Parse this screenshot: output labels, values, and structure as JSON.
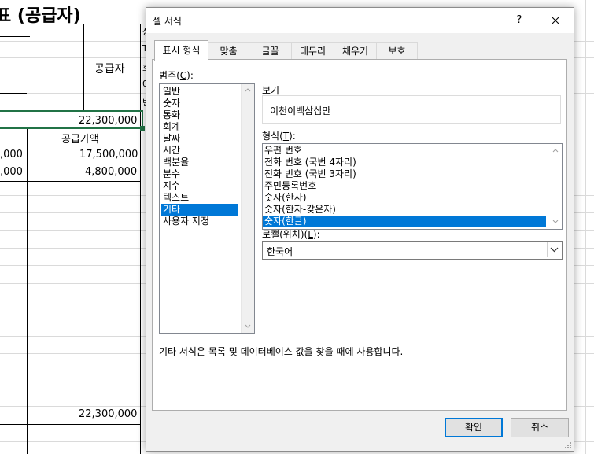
{
  "spreadsheet": {
    "title_fragment": "표 (공급자)",
    "supplier_label": "공급자",
    "total_top": "22,300,000",
    "supply_amount_header": "공급가액",
    "row1_left": ",000",
    "row1_amount": "17,500,000",
    "row2_left": ",000",
    "row2_amount": "4,800,000",
    "total_bottom": "22,300,000",
    "side_chars": [
      "상",
      "T",
      "호",
      "0",
      "빈"
    ]
  },
  "dialog": {
    "title": "셀 서식",
    "help_label": "?",
    "tabs": [
      {
        "label": "표시 형식",
        "active": true
      },
      {
        "label": "맞춤",
        "active": false
      },
      {
        "label": "글꼴",
        "active": false
      },
      {
        "label": "테두리",
        "active": false
      },
      {
        "label": "채우기",
        "active": false
      },
      {
        "label": "보호",
        "active": false
      }
    ],
    "category_label": "범주(",
    "category_key": "C",
    "category_label_end": "):",
    "categories": [
      "일반",
      "숫자",
      "통화",
      "회계",
      "날짜",
      "시간",
      "백분율",
      "분수",
      "지수",
      "텍스트",
      "기타",
      "사용자 지정"
    ],
    "selected_category": "기타",
    "sample_label": "보기",
    "sample_value": "이천이백삼십만",
    "type_label": "형식(",
    "type_key": "T",
    "type_label_end": "):",
    "types": [
      "우편 번호",
      "전화 번호 (국번 4자리)",
      "전화 번호 (국번 3자리)",
      "주민등록번호",
      "숫자(한자)",
      "숫자(한자-갖은자)",
      "숫자(한글)"
    ],
    "selected_type": "숫자(한글)",
    "locale_label": "로캘(위치)(",
    "locale_key": "L",
    "locale_label_end": "):",
    "locale_value": "한국어",
    "description": "기타 서식은 목록 및 데이터베이스 값을 찾을 때에 사용합니다.",
    "ok_label": "확인",
    "cancel_label": "취소"
  },
  "colors": {
    "selection": "#0078d7",
    "excel_green": "#217346",
    "dialog_bg": "#f0f0f0"
  }
}
